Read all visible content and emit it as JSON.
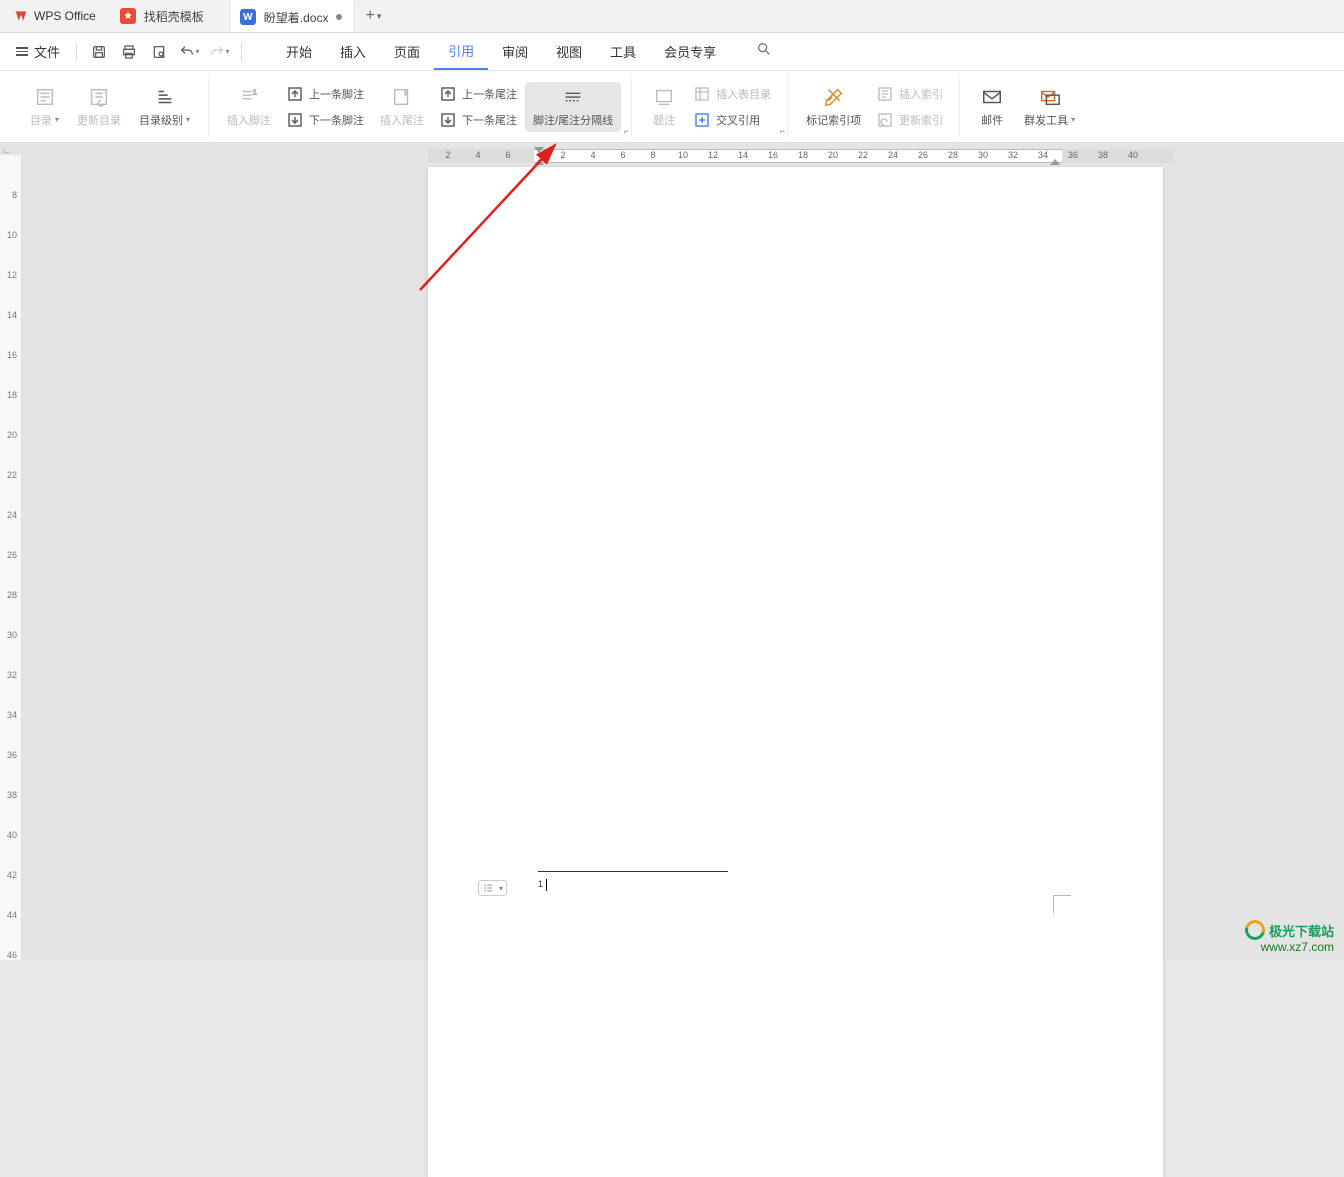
{
  "titlebar": {
    "app_name": "WPS Office",
    "tabs": [
      {
        "label": "找稻壳模板",
        "icon_bg": "#e94b35",
        "icon_text": ""
      },
      {
        "label": "盼望着.docx",
        "icon_bg": "#3b6fd6",
        "icon_text": "W",
        "active": true,
        "dirty": true
      }
    ]
  },
  "menu": {
    "file_label": "文件",
    "tabs": [
      "开始",
      "插入",
      "页面",
      "引用",
      "审阅",
      "视图",
      "工具",
      "会员专享"
    ],
    "active_tab": "引用"
  },
  "ribbon": {
    "group_toc": {
      "toc": "目录",
      "update": "更新目录",
      "level": "目录级别"
    },
    "group_footnote": {
      "insert_footnote": "插入脚注",
      "prev_footnote": "上一条脚注",
      "next_footnote": "下一条脚注",
      "insert_endnote": "插入尾注",
      "prev_endnote": "上一条尾注",
      "next_endnote": "下一条尾注",
      "separator": "脚注/尾注分隔线"
    },
    "group_caption": {
      "caption": "题注",
      "insert_table_toc": "插入表目录",
      "crossref": "交叉引用"
    },
    "group_index": {
      "mark": "标记索引项",
      "insert_index": "插入索引",
      "update_index": "更新索引"
    },
    "group_mail": {
      "mail": "邮件",
      "mass": "群发工具"
    }
  },
  "ruler": {
    "h_left": [
      "6",
      "4",
      "2"
    ],
    "h_right": [
      "2",
      "4",
      "6",
      "8",
      "10",
      "12",
      "14",
      "16",
      "18",
      "20",
      "22",
      "24",
      "26",
      "28",
      "30",
      "32",
      "34",
      "36",
      "38",
      "40"
    ],
    "v": [
      "8",
      "10",
      "12",
      "14",
      "16",
      "18",
      "20",
      "22",
      "24",
      "26",
      "28",
      "30",
      "32",
      "34",
      "36",
      "38",
      "40",
      "42",
      "44",
      "46"
    ]
  },
  "footnote": {
    "marker": "1"
  },
  "watermark": {
    "brand": "极光下载站",
    "url": "www.xz7.com"
  }
}
